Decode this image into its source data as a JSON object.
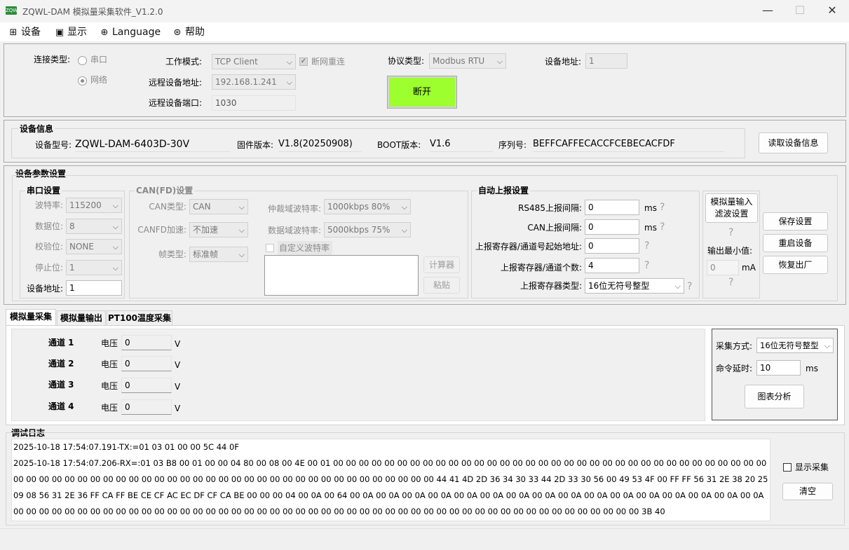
{
  "window": {
    "title": "ZQWL-DAM 模拟量采集软件_V1.2.0",
    "logo": "ZQWL",
    "minimize": "—",
    "maximize": "☐",
    "close": "✕"
  },
  "menu": [
    {
      "icon": "grid-icon",
      "glyph": "⊞",
      "label": "设备"
    },
    {
      "icon": "monitor-icon",
      "glyph": "▣",
      "label": "显示"
    },
    {
      "icon": "globe-icon",
      "glyph": "⊕",
      "label": "Language"
    },
    {
      "icon": "help-icon",
      "glyph": "⊛",
      "label": "帮助"
    }
  ],
  "connection": {
    "type_label": "连接类型:",
    "serial_label": "串口",
    "network_label": "网络",
    "work_mode_label": "工作模式:",
    "work_mode": "TCP Client",
    "reconnect_label": "断网重连",
    "remote_addr_label": "远程设备地址:",
    "remote_addr": "192.168.1.241",
    "remote_port_label": "远程设备端口:",
    "remote_port": "1030",
    "protocol_label": "协议类型:",
    "protocol": "Modbus RTU",
    "disconnect_button": "断开",
    "device_addr_label": "设备地址:",
    "device_addr": "1"
  },
  "device_info": {
    "title": "设备信息",
    "model_label": "设备型号:",
    "model": "ZQWL-DAM-6403D-30V",
    "firmware_label": "固件版本:",
    "firmware": "V1.8(20250908)",
    "boot_label": "BOOT版本:",
    "boot": "V1.6",
    "serial_label": "序列号:",
    "serial": "BEFFCAFFECACCFCEBECACFDF",
    "read_button": "读取设备信息"
  },
  "params": {
    "title": "设备参数设置",
    "serial": {
      "title": "串口设置",
      "baud_label": "波特率:",
      "baud": "115200",
      "data_label": "数据位:",
      "data": "8",
      "parity_label": "校验位:",
      "parity": "NONE",
      "stop_label": "停止位:",
      "stop": "1",
      "addr_label": "设备地址:",
      "addr": "1"
    },
    "can": {
      "title": "CAN(FD)设置",
      "type_label": "CAN类型:",
      "type": "CAN",
      "accel_label": "CANFD加速:",
      "accel": "不加速",
      "frame_label": "帧类型:",
      "frame": "标准帧",
      "arb_label": "仲裁域波特率:",
      "arb": "1000kbps 80%",
      "data_label": "数据域波特率:",
      "data": "5000kbps 75%",
      "custom_label": "自定义波特率",
      "calc_button": "计算器",
      "paste_button": "粘贴"
    },
    "auto": {
      "title": "自动上报设置",
      "rs485_label": "RS485上报间隔:",
      "rs485": "0",
      "can_label": "CAN上报间隔:",
      "can": "0",
      "start_label": "上报寄存器/通道号起始地址:",
      "start": "0",
      "count_label": "上报寄存器/通道个数:",
      "count": "4",
      "regtype_label": "上报寄存器类型:",
      "regtype": "16位无符号整型",
      "unit_ms": "ms",
      "q": "?"
    },
    "filter": {
      "button": "模拟量输入\n滤波设置",
      "min_label": "输出最小值:",
      "min": "0",
      "unit": "mA",
      "q": "?"
    },
    "save_button": "保存设置",
    "restart_button": "重启设备",
    "factory_button": "恢复出厂"
  },
  "tabs": [
    "模拟量采集",
    "模拟量输出",
    "PT100温度采集"
  ],
  "channels": [
    {
      "name": "通道 1",
      "label": "电压",
      "value": "0",
      "unit": "V"
    },
    {
      "name": "通道 2",
      "label": "电压",
      "value": "0",
      "unit": "V"
    },
    {
      "name": "通道 3",
      "label": "电压",
      "value": "0",
      "unit": "V"
    },
    {
      "name": "通道 4",
      "label": "电压",
      "value": "0",
      "unit": "V"
    }
  ],
  "acq": {
    "mode_label": "采集方式:",
    "mode": "16位无符号整型",
    "delay_label": "命令延时:",
    "delay": "10",
    "unit": "ms",
    "chart_button": "图表分析"
  },
  "log": {
    "title": "调试日志",
    "line1": "2025-10-18 17:54:07.191-TX:=01 03 01 00 00 5C 44 0F",
    "line2": "2025-10-18 17:54:07.206-RX=:01 03 B8 00 01 00 00 04 80 00 08 00 4E 00 01 00 00 00 00 00 00 00 00 00 00 00 00 00 00 00 00 00 00 00 00 00 00 00 00 00 00 00 00 00 00 00 00 00 00 00 00 00 00 00 00 00 00 00 00 00 00 00 00 00 00 00 00 00 00 00 00 00 00 00 00 00 00 00 00 00 00 00 44 41 4D 2D 36 34 30 33 44 2D 33 30 56 00 49 53 4F 00 FF FF 56 31 2E 38 20 25 09 08 56 31 2E 36 FF CA FF BE CE CF AC EC DF CF CA BE 00 00 00 04 00 0A 00 64 00 0A 00 0A 00 0A 00 0A 00 0A 00 0A 00 0A 00 0A 00 0A 00 0A 00 0A 00 0A 00 0A 00 0A 00 0A 00 0A 00 00 00 00 00 00 00 00 00 00 00 00 00 00 00 00 00 00 00 00 00 00 00 00 00 00 00 00 00 00 00 00 00 00 00 00 00 00 00 00 00 00 00 00 00 00 00 00 00 3B 40",
    "show_label": "显示采集",
    "clear_button": "清空"
  },
  "colors": {
    "connect_button": "#9dff2e"
  }
}
